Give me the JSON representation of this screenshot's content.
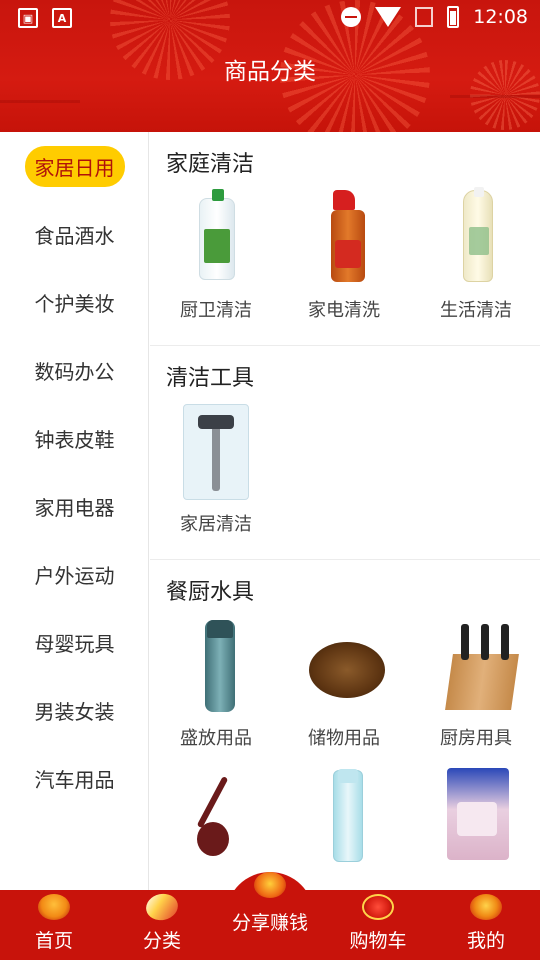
{
  "status_bar": {
    "time": "12:08",
    "left_icons": [
      "image-icon",
      "font-icon"
    ],
    "right_icons": [
      "do-not-disturb-icon",
      "wifi-icon",
      "no-sim-icon",
      "battery-charging-icon"
    ]
  },
  "header": {
    "title": "商品分类"
  },
  "sidebar": {
    "items": [
      {
        "label": "家居日用",
        "active": true
      },
      {
        "label": "食品酒水",
        "active": false
      },
      {
        "label": "个护美妆",
        "active": false
      },
      {
        "label": "数码办公",
        "active": false
      },
      {
        "label": "钟表皮鞋",
        "active": false
      },
      {
        "label": "家用电器",
        "active": false
      },
      {
        "label": "户外运动",
        "active": false
      },
      {
        "label": "母婴玩具",
        "active": false
      },
      {
        "label": "男装女装",
        "active": false
      },
      {
        "label": "汽车用品",
        "active": false
      }
    ]
  },
  "sections": [
    {
      "title": "家庭清洁",
      "products": [
        {
          "label": "厨卫清洁",
          "icon": "detergent-bottle-image"
        },
        {
          "label": "家电清洗",
          "icon": "spray-bottle-image"
        },
        {
          "label": "生活清洁",
          "icon": "cleanser-bottle-image"
        }
      ]
    },
    {
      "title": "清洁工具",
      "products": [
        {
          "label": "家居清洁",
          "icon": "mop-package-image"
        }
      ]
    },
    {
      "title": "餐厨水具",
      "products": [
        {
          "label": "盛放用品",
          "icon": "thermos-image"
        },
        {
          "label": "储物用品",
          "icon": "wooden-bowl-image"
        },
        {
          "label": "厨房用具",
          "icon": "knife-block-image"
        },
        {
          "label": "",
          "icon": "wooden-spoon-image"
        },
        {
          "label": "",
          "icon": "water-bottle-image"
        },
        {
          "label": "",
          "icon": "snack-bag-image"
        }
      ]
    }
  ],
  "tabbar": {
    "items": [
      {
        "label": "首页",
        "icon": "home-lantern-icon"
      },
      {
        "label": "分类",
        "icon": "category-icon",
        "active": true
      },
      {
        "label": "分享赚钱",
        "icon": "share-earn-icon"
      },
      {
        "label": "购物车",
        "icon": "cart-icon"
      },
      {
        "label": "我的",
        "icon": "profile-icon"
      }
    ]
  },
  "colors": {
    "brand_red": "#c8150d",
    "active_badge": "#ffcc00"
  }
}
